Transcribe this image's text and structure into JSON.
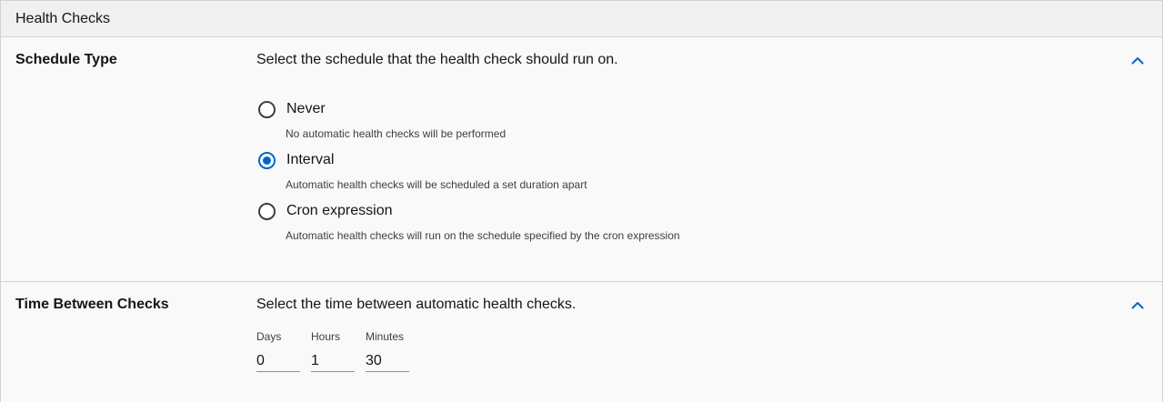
{
  "panel": {
    "title": "Health Checks"
  },
  "schedule": {
    "label": "Schedule Type",
    "description": "Select the schedule that the health check should run on.",
    "selected": "Interval",
    "options": [
      {
        "label": "Never",
        "help": "No automatic health checks will be performed",
        "checked": false
      },
      {
        "label": "Interval",
        "help": "Automatic health checks will be scheduled a set duration apart",
        "checked": true
      },
      {
        "label": "Cron expression",
        "help": "Automatic health checks will run on the schedule specified by the cron expression",
        "checked": false
      }
    ]
  },
  "interval": {
    "label": "Time Between Checks",
    "description": "Select the time between automatic health checks.",
    "days": {
      "label": "Days",
      "value": "0"
    },
    "hours": {
      "label": "Hours",
      "value": "1"
    },
    "minutes": {
      "label": "Minutes",
      "value": "30"
    }
  },
  "icons": {
    "collapse": "chevron-up-icon"
  },
  "colors": {
    "accent": "#0066cc",
    "header_bg": "#f0f0f0",
    "body_bg": "#f9f9f9",
    "border": "#d2d2d2"
  }
}
